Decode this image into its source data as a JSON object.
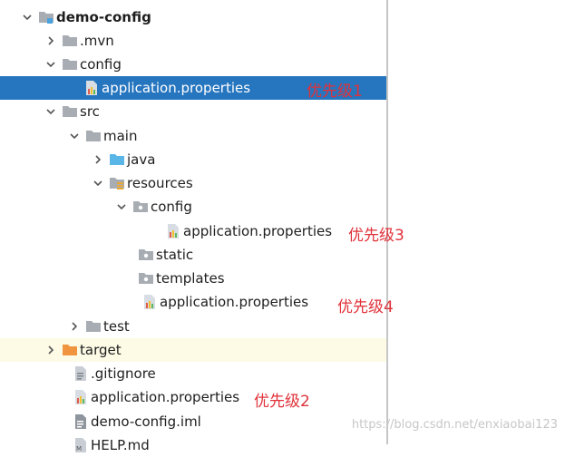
{
  "tree": {
    "rows": [
      {
        "label": "demo-config",
        "icon": "module-folder-icon",
        "chevron": "expanded"
      },
      {
        "label": ".mvn",
        "icon": "folder-icon",
        "chevron": "collapsed"
      },
      {
        "label": "config",
        "icon": "folder-icon",
        "chevron": "expanded"
      },
      {
        "label": "application.properties",
        "icon": "properties-file-icon",
        "chevron": "none",
        "selected": true
      },
      {
        "label": "src",
        "icon": "folder-icon",
        "chevron": "expanded"
      },
      {
        "label": "main",
        "icon": "folder-icon",
        "chevron": "expanded"
      },
      {
        "label": "java",
        "icon": "source-folder-icon",
        "chevron": "collapsed"
      },
      {
        "label": "resources",
        "icon": "resources-folder-icon",
        "chevron": "expanded"
      },
      {
        "label": "config",
        "icon": "package-folder-icon",
        "chevron": "expanded"
      },
      {
        "label": "application.properties",
        "icon": "properties-file-icon",
        "chevron": "none"
      },
      {
        "label": "static",
        "icon": "package-folder-icon",
        "chevron": "none"
      },
      {
        "label": "templates",
        "icon": "package-folder-icon",
        "chevron": "none"
      },
      {
        "label": "application.properties",
        "icon": "properties-file-icon",
        "chevron": "none"
      },
      {
        "label": "test",
        "icon": "folder-icon",
        "chevron": "collapsed"
      },
      {
        "label": "target",
        "icon": "excluded-folder-icon",
        "chevron": "collapsed",
        "excluded": true
      },
      {
        "label": ".gitignore",
        "icon": "text-file-icon",
        "chevron": "none"
      },
      {
        "label": "application.properties",
        "icon": "properties-file-icon",
        "chevron": "none"
      },
      {
        "label": "demo-config.iml",
        "icon": "iml-file-icon",
        "chevron": "none"
      },
      {
        "label": "HELP.md",
        "icon": "markdown-file-icon",
        "chevron": "none"
      }
    ]
  },
  "annotations": [
    {
      "text": "优先级1"
    },
    {
      "text": "优先级3"
    },
    {
      "text": "优先级4"
    },
    {
      "text": "优先级2"
    }
  ],
  "watermark": "https://blog.csdn.net/enxiaobai123",
  "colors": {
    "selection": "#2675bf",
    "annotation": "#e0323a",
    "folder": "#a8adb4",
    "excluded_folder": "#f0943f",
    "source_folder": "#5bb6e8"
  }
}
